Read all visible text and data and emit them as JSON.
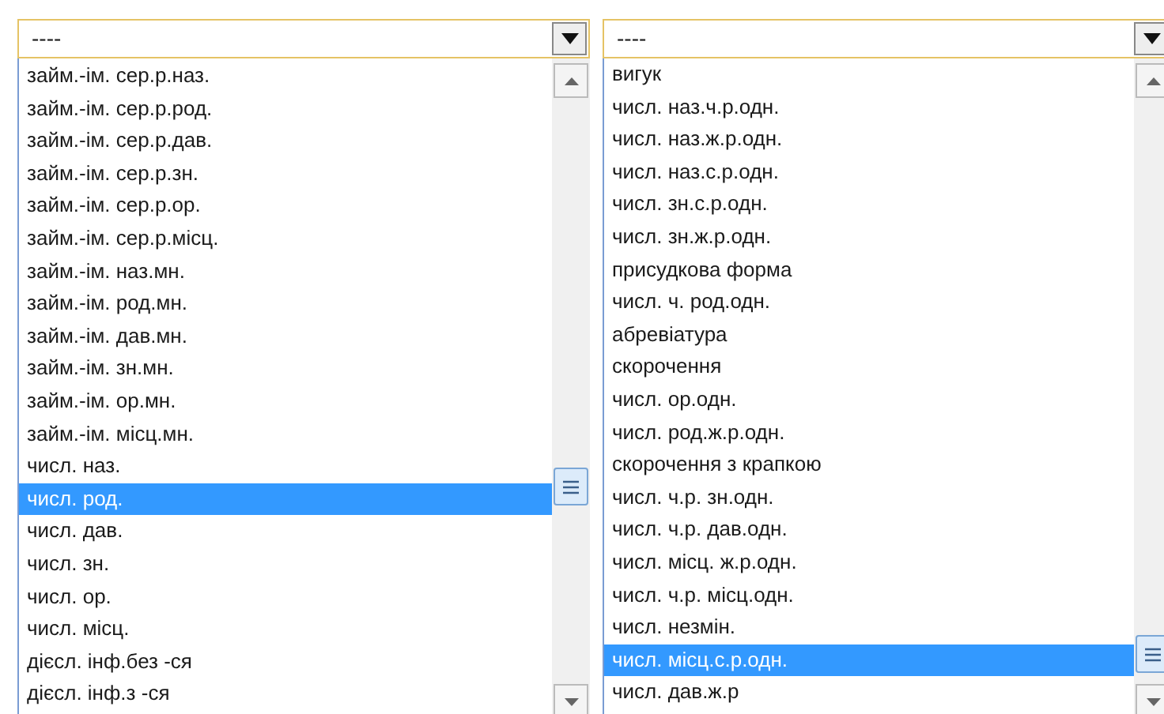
{
  "dropdowns": [
    {
      "value": "----",
      "options": [
        {
          "label": "займ.-ім. сер.р.наз.",
          "selected": false
        },
        {
          "label": "займ.-ім. сер.р.род.",
          "selected": false
        },
        {
          "label": "займ.-ім. сер.р.дав.",
          "selected": false
        },
        {
          "label": "займ.-ім. сер.р.зн.",
          "selected": false
        },
        {
          "label": "займ.-ім. сер.р.ор.",
          "selected": false
        },
        {
          "label": "займ.-ім. сер.р.місц.",
          "selected": false
        },
        {
          "label": "займ.-ім. наз.мн.",
          "selected": false
        },
        {
          "label": "займ.-ім. род.мн.",
          "selected": false
        },
        {
          "label": "займ.-ім. дав.мн.",
          "selected": false
        },
        {
          "label": "займ.-ім. зн.мн.",
          "selected": false
        },
        {
          "label": "займ.-ім. ор.мн.",
          "selected": false
        },
        {
          "label": "займ.-ім. місц.мн.",
          "selected": false
        },
        {
          "label": "числ. наз.",
          "selected": false
        },
        {
          "label": "числ. род.",
          "selected": true
        },
        {
          "label": "числ. дав.",
          "selected": false
        },
        {
          "label": "числ. зн.",
          "selected": false
        },
        {
          "label": "числ. ор.",
          "selected": false
        },
        {
          "label": "числ. місц.",
          "selected": false
        },
        {
          "label": "дієсл. інф.без -ся",
          "selected": false
        },
        {
          "label": "дієсл. інф.з -ся",
          "selected": false
        }
      ]
    },
    {
      "value": "----",
      "options": [
        {
          "label": "вигук",
          "selected": false
        },
        {
          "label": "числ. наз.ч.р.одн.",
          "selected": false
        },
        {
          "label": "числ. наз.ж.р.одн.",
          "selected": false
        },
        {
          "label": "числ. наз.с.р.одн.",
          "selected": false
        },
        {
          "label": "числ. зн.с.р.одн.",
          "selected": false
        },
        {
          "label": "числ. зн.ж.р.одн.",
          "selected": false
        },
        {
          "label": "присудкова форма",
          "selected": false
        },
        {
          "label": "числ. ч. род.одн.",
          "selected": false
        },
        {
          "label": "абревіатура",
          "selected": false
        },
        {
          "label": "скорочення",
          "selected": false
        },
        {
          "label": "числ. ор.одн.",
          "selected": false
        },
        {
          "label": "числ. род.ж.р.одн.",
          "selected": false
        },
        {
          "label": "скорочення з крапкою",
          "selected": false
        },
        {
          "label": "числ. ч.р. зн.одн.",
          "selected": false
        },
        {
          "label": "числ. ч.р. дав.одн.",
          "selected": false
        },
        {
          "label": "числ. місц. ж.р.одн.",
          "selected": false
        },
        {
          "label": "числ. ч.р. місц.одн.",
          "selected": false
        },
        {
          "label": "числ. незмін.",
          "selected": false
        },
        {
          "label": "числ. місц.с.р.одн.",
          "selected": true
        },
        {
          "label": "числ. дав.ж.р",
          "selected": false
        }
      ]
    }
  ]
}
